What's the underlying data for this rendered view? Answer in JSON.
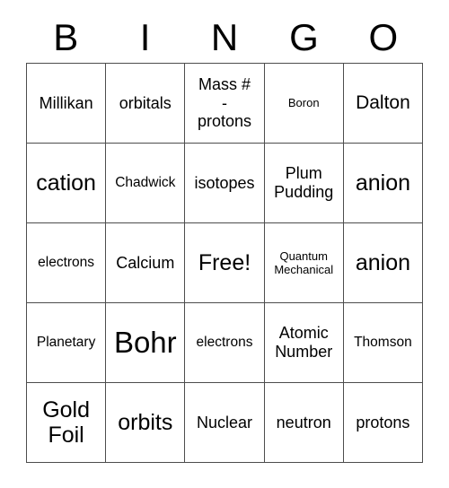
{
  "header": {
    "letters": [
      "B",
      "I",
      "N",
      "G",
      "O"
    ]
  },
  "grid": {
    "columns": 5,
    "rows": 5,
    "cells": [
      [
        {
          "text": "Millikan",
          "size": "md"
        },
        {
          "text": "orbitals",
          "size": "md"
        },
        {
          "text": "Mass #\n-\nprotons",
          "size": "md"
        },
        {
          "text": "Boron",
          "size": "xs"
        },
        {
          "text": "Dalton",
          "size": "lg"
        }
      ],
      [
        {
          "text": "cation",
          "size": "xl"
        },
        {
          "text": "Chadwick",
          "size": "sm"
        },
        {
          "text": "isotopes",
          "size": "md"
        },
        {
          "text": "Plum\nPudding",
          "size": "md"
        },
        {
          "text": "anion",
          "size": "xl"
        }
      ],
      [
        {
          "text": "electrons",
          "size": "sm"
        },
        {
          "text": "Calcium",
          "size": "md"
        },
        {
          "text": "Free!",
          "size": "xl"
        },
        {
          "text": "Quantum\nMechanical",
          "size": "xs"
        },
        {
          "text": "anion",
          "size": "xl"
        }
      ],
      [
        {
          "text": "Planetary",
          "size": "sm"
        },
        {
          "text": "Bohr",
          "size": "xxl"
        },
        {
          "text": "electrons",
          "size": "sm"
        },
        {
          "text": "Atomic\nNumber",
          "size": "md"
        },
        {
          "text": "Thomson",
          "size": "sm"
        }
      ],
      [
        {
          "text": "Gold\nFoil",
          "size": "xl"
        },
        {
          "text": "orbits",
          "size": "xl"
        },
        {
          "text": "Nuclear",
          "size": "md"
        },
        {
          "text": "neutron",
          "size": "md"
        },
        {
          "text": "protons",
          "size": "md"
        }
      ]
    ]
  },
  "colors": {
    "background": "#ffffff",
    "text": "#000000",
    "gridline": "#4d4d4d"
  }
}
